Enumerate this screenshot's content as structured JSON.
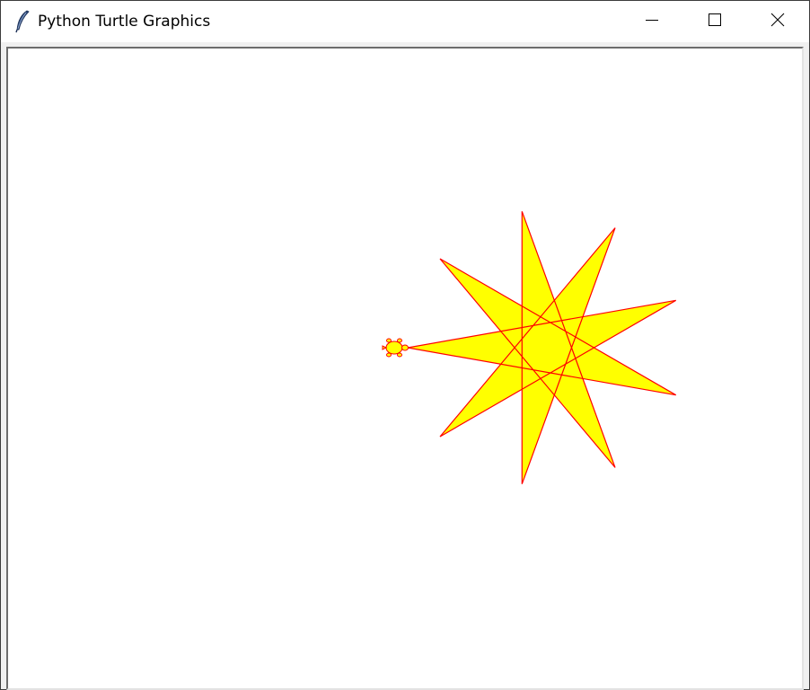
{
  "window": {
    "title": "Python Turtle Graphics",
    "app_icon": "feather-icon",
    "controls": {
      "minimize_icon": "minimize-icon",
      "maximize_icon": "maximize-icon",
      "close_icon": "close-icon"
    }
  },
  "canvas": {
    "background": "#ffffff",
    "drawing": {
      "shape": "nine-pointed star",
      "pen_color": "#ff0000",
      "fill_color": "#ffff00"
    },
    "turtle": {
      "shape": "turtle",
      "outline_color": "#ff0000",
      "fill_color": "#ffff00"
    }
  }
}
